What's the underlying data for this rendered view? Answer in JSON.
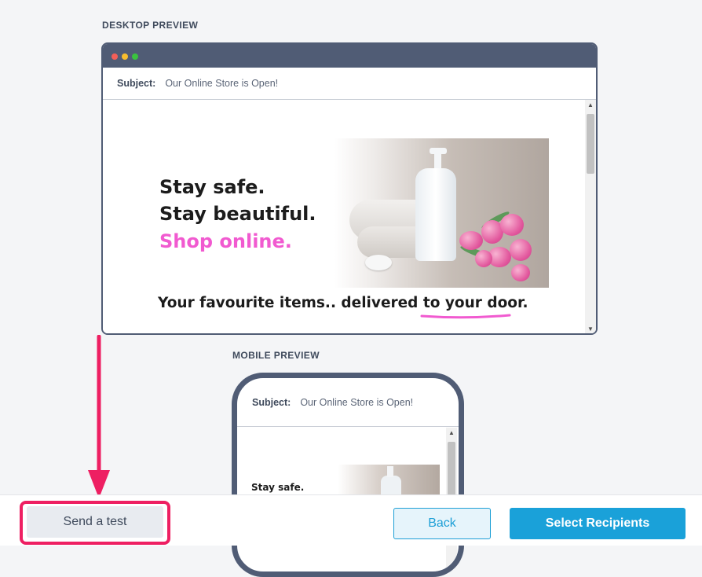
{
  "desktop_preview": {
    "section_label": "DESKTOP PREVIEW",
    "subject_label": "Subject:",
    "subject_value": "Our Online Store is Open!",
    "hero": {
      "line1": "Stay safe.",
      "line2": "Stay beautiful.",
      "line3": "Shop online.",
      "tagline": "Your favourite items.. delivered to your door."
    },
    "colors": {
      "frame": "#505c75",
      "accent_pink": "#f15ad0"
    }
  },
  "mobile_preview": {
    "section_label": "MOBILE PREVIEW",
    "subject_label": "Subject:",
    "subject_value": "Our Online Store is Open!",
    "hero_line1": "Stay safe."
  },
  "footer": {
    "send_test_label": "Send a test",
    "back_label": "Back",
    "select_recipients_label": "Select Recipients"
  },
  "colors": {
    "primary": "#1aa1d9",
    "annotation": "#ee1f62"
  }
}
